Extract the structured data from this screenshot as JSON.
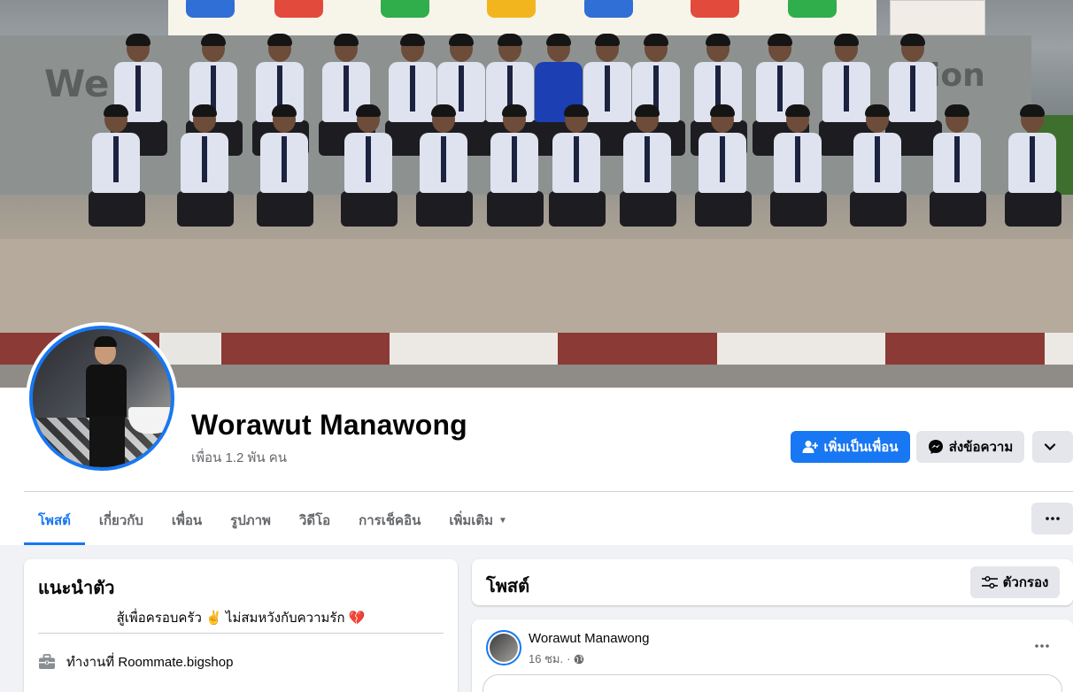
{
  "profile": {
    "name": "Worawut Manawong",
    "friends_count": "เพื่อน 1.2 พัน คน"
  },
  "actions": {
    "add_friend": "เพิ่มเป็นเพื่อน",
    "message": "ส่งข้อความ"
  },
  "tabs": [
    {
      "label": "โพสต์",
      "active": true
    },
    {
      "label": "เกี่ยวกับ",
      "active": false
    },
    {
      "label": "เพื่อน",
      "active": false
    },
    {
      "label": "รูปภาพ",
      "active": false
    },
    {
      "label": "วิดีโอ",
      "active": false
    },
    {
      "label": "การเช็คอิน",
      "active": false
    },
    {
      "label": "เพิ่มเติม",
      "active": false
    }
  ],
  "intro": {
    "title": "แนะนำตัว",
    "bio": "สู้เพื่อครอบครัว ✌️ ไม่สมหวังกับความรัก 💔",
    "work": "ทำงานที่ Roommate.bigshop"
  },
  "posts_section": {
    "title": "โพสต์",
    "filter_label": "ตัวกรอง"
  },
  "post": {
    "author": "Worawut Manawong",
    "time": "16 ชม.",
    "separator": "·"
  },
  "icons": {
    "add_friend": "person-plus-icon",
    "message": "messenger-icon",
    "chevron": "chevron-down-icon",
    "more": "more-horizontal-icon",
    "filter": "filter-sliders-icon",
    "work": "briefcase-icon",
    "privacy": "globe-icon"
  },
  "colors": {
    "accent": "#1877f2",
    "background": "#f0f2f5",
    "secondary_button": "#e4e6eb",
    "muted_text": "#65676b"
  }
}
